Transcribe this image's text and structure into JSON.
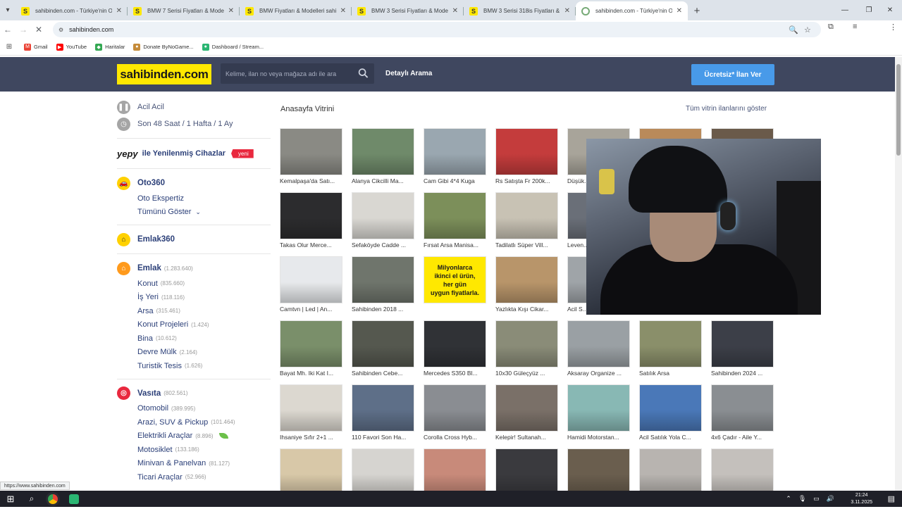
{
  "browser": {
    "tabs": [
      {
        "title": "sahibinden.com - Türkiye'nin O",
        "favicon": "S",
        "active": false
      },
      {
        "title": "BMW 7 Serisi Fiyatları & Model",
        "favicon": "S",
        "active": false
      },
      {
        "title": "BMW Fiyatları & Modelleri sahi",
        "favicon": "S",
        "active": false
      },
      {
        "title": "BMW 3 Serisi Fiyatları & Model",
        "favicon": "S",
        "active": false
      },
      {
        "title": "BMW 3 Serisi 318is Fiyatları & M",
        "favicon": "S",
        "active": false
      },
      {
        "title": "sahibinden.com - Türkiye'nin O",
        "favicon": "",
        "active": true
      }
    ],
    "address": "sahibinden.com",
    "bookmarks": [
      {
        "label": "Gmail",
        "color": "#ea4335",
        "glyph": "M"
      },
      {
        "label": "YouTube",
        "color": "#ff0000",
        "glyph": "▶"
      },
      {
        "label": "Haritalar",
        "color": "#34a853",
        "glyph": "◆"
      },
      {
        "label": "Donate ByNoGame...",
        "color": "#c58b3a",
        "glyph": "●"
      },
      {
        "label": "Dashboard / Stream...",
        "color": "#2bb673",
        "glyph": "●"
      }
    ],
    "status_url": "https://www.sahibinden.com"
  },
  "header": {
    "logo": "sahibinden.com",
    "search_placeholder": "Kelime, ilan no veya mağaza adı ile ara",
    "detailed_search": "Detaylı Arama",
    "post_ad": "Ücretsiz* İlan Ver"
  },
  "sidebar": {
    "quick": [
      {
        "label": "Acil Acil",
        "icon": "pause-icon"
      },
      {
        "label": "Son 48 Saat / 1 Hafta / 1 Ay",
        "icon": "clock-icon"
      }
    ],
    "yepy": {
      "logo": "yepy",
      "label": "ile Yenilenmiş Cihazlar",
      "badge": "yeni"
    },
    "oto360": {
      "title": "Oto360",
      "items": [
        "Oto Ekspertiz",
        "Tümünü Göster"
      ]
    },
    "emlak360": {
      "title": "Emlak360"
    },
    "emlak": {
      "title": "Emlak",
      "count": "(1.283.640)",
      "items": [
        {
          "label": "Konut",
          "count": "(835.660)"
        },
        {
          "label": "İş Yeri",
          "count": "(118.116)"
        },
        {
          "label": "Arsa",
          "count": "(315.461)"
        },
        {
          "label": "Konut Projeleri",
          "count": "(1.424)"
        },
        {
          "label": "Bina",
          "count": "(10.612)"
        },
        {
          "label": "Devre Mülk",
          "count": "(2.164)"
        },
        {
          "label": "Turistik Tesis",
          "count": "(1.626)"
        }
      ]
    },
    "vasita": {
      "title": "Vasıta",
      "count": "(802.561)",
      "items": [
        {
          "label": "Otomobil",
          "count": "(389.995)"
        },
        {
          "label": "Arazi, SUV & Pickup",
          "count": "(101.464)"
        },
        {
          "label": "Elektrikli Araçlar",
          "count": "(8.896)"
        },
        {
          "label": "Motosiklet",
          "count": "(133.186)"
        },
        {
          "label": "Minivan & Panelvan",
          "count": "(81.127)"
        },
        {
          "label": "Ticari Araçlar",
          "count": "(52.966)"
        }
      ]
    }
  },
  "main": {
    "title": "Anasayfa Vitrini",
    "show_all": "Tüm vitrin ilanlarını göster",
    "ad_tile": {
      "line1": "Milyonlarca",
      "line2": "ikinci el ürün,",
      "line3": "her gün",
      "line4": "uygun fiyatlarla."
    },
    "rows": [
      [
        "Kemalpaşa'da Satı...",
        "Alanya Cikcilli Ma...",
        "Cam Gibi 4*4 Kuga",
        "Rs Satışta Fr 200k...",
        "Düşük...",
        "",
        ""
      ],
      [
        "Takas Olur Merce...",
        "Sefaköyde Cadde ...",
        "Fırsat Arsa Manisa...",
        "Tadilatlı Süper Vill...",
        "Leven...",
        "",
        ""
      ],
      [
        "Camtvn | Led | An...",
        "Sahibinden 2018 ...",
        "",
        "Yazlıkta Kışı Cikar...",
        "Acil S...",
        "",
        ""
      ],
      [
        "Bayat Mh. Iki Kat I...",
        "Sahibinden Cebe...",
        "Mercedes S350 Bl...",
        "10x30 Güleçyüz ...",
        "Aksaray Organize ...",
        "Satılık Arsa",
        "Sahibinden 2024 ..."
      ],
      [
        "Ihsaniye Sıfır 2+1 ...",
        "110 Favori Son Ha...",
        "Corolla Cross Hyb...",
        "Kelepir! Sultanah...",
        "Hamidi Motorstan...",
        "Acil Satılık Yola C...",
        "4x6 Çadır - Aile Y..."
      ],
      [
        "",
        "",
        "",
        "",
        "",
        "",
        ""
      ]
    ],
    "thumb_colors": [
      [
        "#8a8a84",
        "#6f8a6a",
        "#9aa7b0",
        "#c43c3c",
        "#a8a49a",
        "#b98a5a",
        "#6a5a4a"
      ],
      [
        "#2c2c2e",
        "#d9d7d2",
        "#7c8f5a",
        "#c8c2b4",
        "#6a6f78",
        "#9a9a9a",
        "#aaaaaa"
      ],
      [
        "#e7e9ec",
        "#6f756c",
        "#ffe800",
        "#b8956a",
        "#9fa4a8",
        "#9a9a9a",
        "#aaaaaa"
      ],
      [
        "#7a8f6a",
        "#55584f",
        "#303236",
        "#8a8c78",
        "#9aa0a4",
        "#8a8f6a",
        "#3c3f48"
      ],
      [
        "#dcd8d0",
        "#5e6f88",
        "#8a8d92",
        "#7a7068",
        "#88b8b4",
        "#4a78b8",
        "#8a8e92"
      ],
      [
        "#d8c8a8",
        "#d6d4d0",
        "#c88a7a",
        "#3a3a3e",
        "#6a5e4e",
        "#b8b4b0",
        "#c4c0bc"
      ]
    ]
  },
  "taskbar": {
    "time": "21:24",
    "date": "3.11.2025"
  }
}
